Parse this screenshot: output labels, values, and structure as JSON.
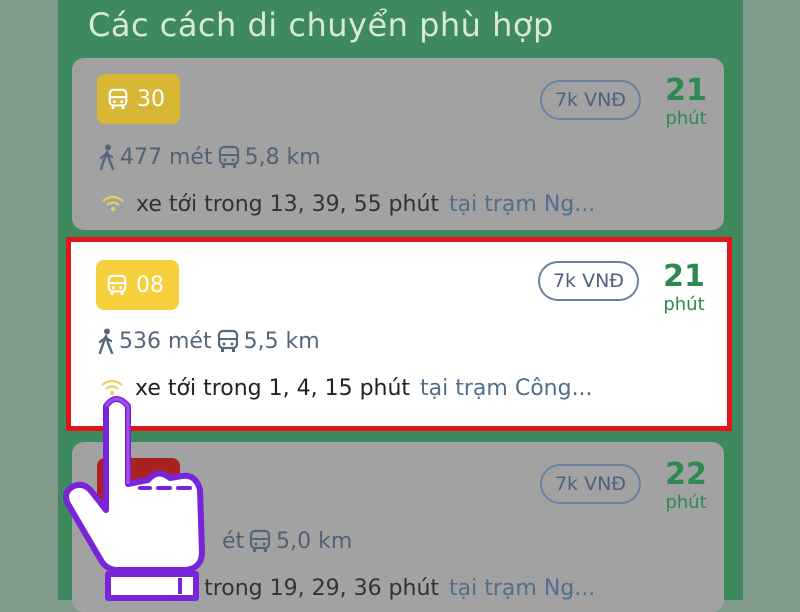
{
  "header": {
    "title": "Các cách di chuyển phù hợp"
  },
  "routes": [
    {
      "number": "30",
      "badge_color": "#d8b734",
      "price": "7k VNĐ",
      "duration": "21",
      "duration_unit": "phút",
      "walk": "477 mét",
      "ride": "5,8 km",
      "eta": "xe tới trong 13, 39, 55 phút",
      "station": "tại trạm Ng...",
      "state": "dim"
    },
    {
      "number": "08",
      "badge_color": "#f6cf3c",
      "price": "7k VNĐ",
      "duration": "21",
      "duration_unit": "phút",
      "walk": "536 mét",
      "ride": "5,5 km",
      "eta": "xe tới trong 1, 4, 15 phút",
      "station": "tại trạm Công...",
      "state": "highlighted"
    },
    {
      "number": "",
      "badge_color": "#a8231f",
      "price": "7k VNĐ",
      "duration": "22",
      "duration_unit": "phút",
      "walk": "",
      "ride": "5,0 km",
      "eta": "xe tới trong 19, 29, 36 phút",
      "station": "tại trạm Ng...",
      "state": "dim"
    }
  ],
  "colors": {
    "panel": "#3e8a5e",
    "highlight_border": "#e4141b",
    "duration": "#2f8a4f",
    "signal": "#e8d15a"
  },
  "icons": [
    "bus-icon",
    "walk-icon",
    "signal-icon",
    "pointing-hand-icon"
  ]
}
